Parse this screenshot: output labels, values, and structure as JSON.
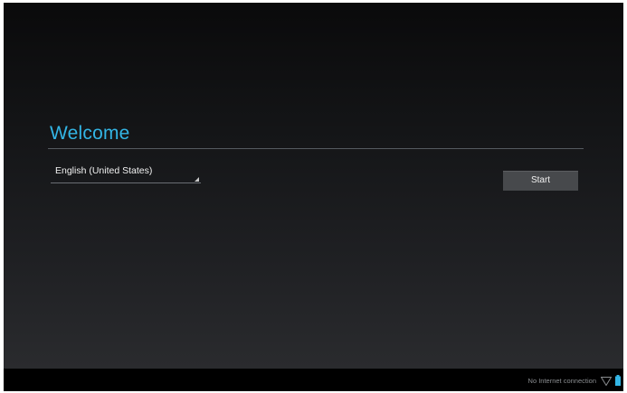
{
  "setup": {
    "title": "Welcome",
    "language": "English (United States)",
    "start_label": "Start"
  },
  "status_bar": {
    "connection_text": "No Internet connection",
    "icons": [
      "wifi-signal-icon",
      "battery-icon"
    ]
  },
  "colors": {
    "accent": "#33b5e5",
    "button": "#47494c",
    "nav_bar": "#000000"
  }
}
